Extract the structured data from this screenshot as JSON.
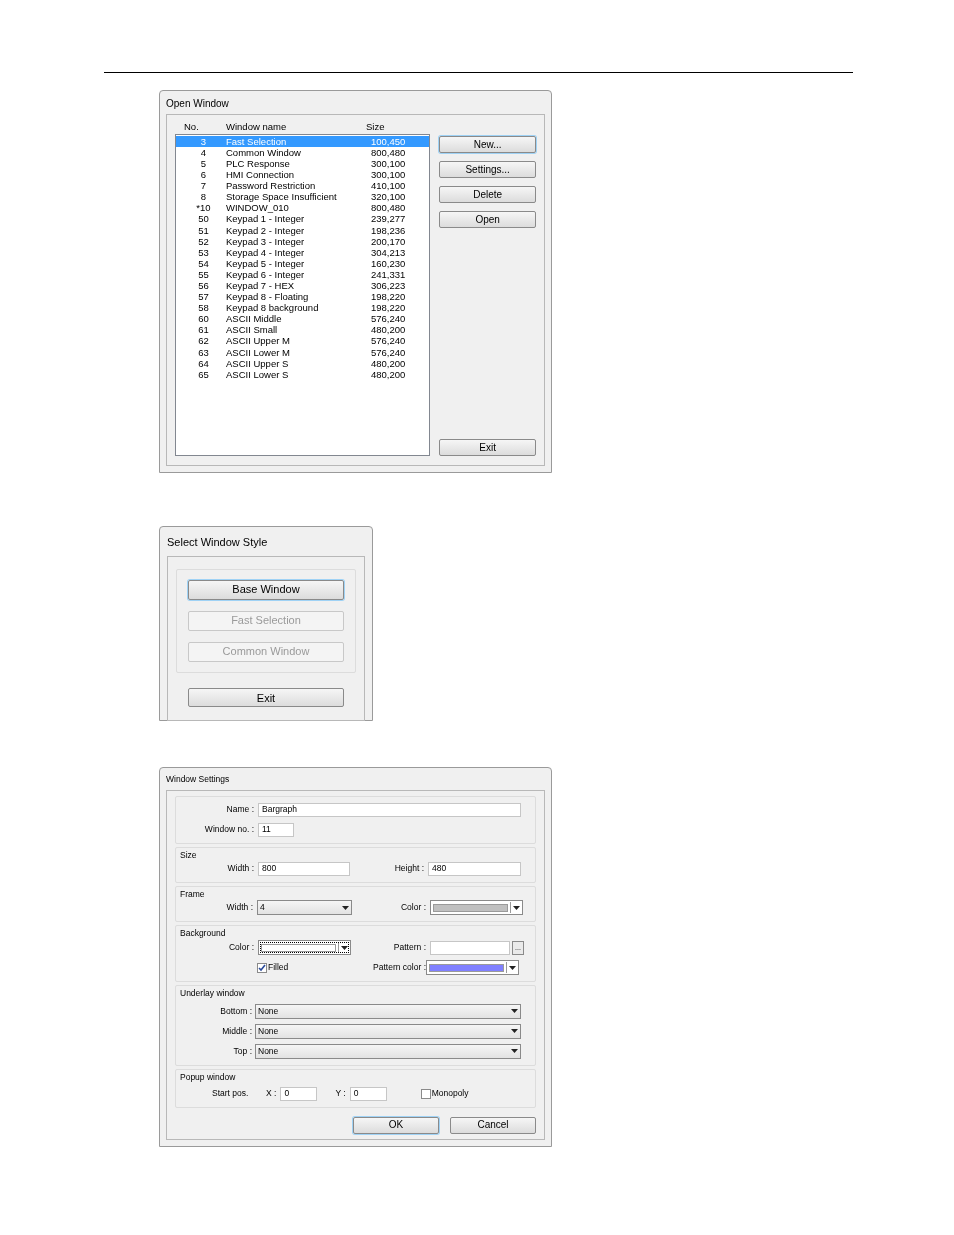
{
  "open_window": {
    "title": "Open Window",
    "columns": [
      "No.",
      "Window name",
      "Size"
    ],
    "rows": [
      {
        "no": "3",
        "name": "Fast Selection",
        "size": "100,450",
        "selected": true
      },
      {
        "no": "4",
        "name": "Common Window",
        "size": "800,480",
        "selected": false
      },
      {
        "no": "5",
        "name": "PLC Response",
        "size": "300,100",
        "selected": false
      },
      {
        "no": "6",
        "name": "HMI Connection",
        "size": "300,100",
        "selected": false
      },
      {
        "no": "7",
        "name": "Password Restriction",
        "size": "410,100",
        "selected": false
      },
      {
        "no": "8",
        "name": "Storage Space Insufficient",
        "size": "320,100",
        "selected": false
      },
      {
        "no": "*10",
        "name": "WINDOW_010",
        "size": "800,480",
        "selected": false
      },
      {
        "no": "50",
        "name": "Keypad 1 - Integer",
        "size": "239,277",
        "selected": false
      },
      {
        "no": "51",
        "name": "Keypad 2 - Integer",
        "size": "198,236",
        "selected": false
      },
      {
        "no": "52",
        "name": "Keypad 3 - Integer",
        "size": "200,170",
        "selected": false
      },
      {
        "no": "53",
        "name": "Keypad 4 - Integer",
        "size": "304,213",
        "selected": false
      },
      {
        "no": "54",
        "name": "Keypad 5 - Integer",
        "size": "160,230",
        "selected": false
      },
      {
        "no": "55",
        "name": "Keypad 6 - Integer",
        "size": "241,331",
        "selected": false
      },
      {
        "no": "56",
        "name": "Keypad 7 - HEX",
        "size": "306,223",
        "selected": false
      },
      {
        "no": "57",
        "name": "Keypad 8 - Floating",
        "size": "198,220",
        "selected": false
      },
      {
        "no": "58",
        "name": "Keypad 8 background",
        "size": "198,220",
        "selected": false
      },
      {
        "no": "60",
        "name": "ASCII Middle",
        "size": "576,240",
        "selected": false
      },
      {
        "no": "61",
        "name": "ASCII Small",
        "size": "480,200",
        "selected": false
      },
      {
        "no": "62",
        "name": "ASCII Upper M",
        "size": "576,240",
        "selected": false
      },
      {
        "no": "63",
        "name": "ASCII Lower M",
        "size": "576,240",
        "selected": false
      },
      {
        "no": "64",
        "name": "ASCII Upper S",
        "size": "480,200",
        "selected": false
      },
      {
        "no": "65",
        "name": "ASCII Lower S",
        "size": "480,200",
        "selected": false
      }
    ],
    "buttons": [
      {
        "label": "New...",
        "focused": true
      },
      {
        "label": "Settings...",
        "focused": false
      },
      {
        "label": "Delete",
        "focused": false
      },
      {
        "label": "Open",
        "focused": false
      }
    ],
    "exit": "Exit"
  },
  "select_style": {
    "title": "Select Window Style",
    "options": [
      {
        "label": "Base Window",
        "disabled": false,
        "focused": true
      },
      {
        "label": "Fast Selection",
        "disabled": true,
        "focused": false
      },
      {
        "label": "Common Window",
        "disabled": true,
        "focused": false
      }
    ],
    "exit": "Exit"
  },
  "window_settings": {
    "title": "Window Settings",
    "general": [
      {
        "label": "Name :",
        "value": "Bargraph"
      },
      {
        "label": "Window no. :",
        "value": "11"
      }
    ],
    "size": {
      "title": "Size",
      "width": {
        "label": "Width :",
        "value": "800"
      },
      "height": {
        "label": "Height :",
        "value": "480"
      }
    },
    "frame": {
      "title": "Frame",
      "width": {
        "label": "Width :",
        "value": "4"
      },
      "color": {
        "label": "Color :",
        "color": "#c0c0c0"
      }
    },
    "background": {
      "title": "Background",
      "color": {
        "label": "Color :",
        "color": "#ffffff"
      },
      "pattern": {
        "label": "Pattern :",
        "button": "..."
      },
      "filled": {
        "label": "Filled",
        "checked": true
      },
      "pattern_color": {
        "label": "Pattern color :",
        "color": "#8080ff"
      }
    },
    "underlay": {
      "title": "Underlay window",
      "selects": [
        {
          "label": "Bottom :",
          "value": "None"
        },
        {
          "label": "Middle :",
          "value": "None"
        },
        {
          "label": "Top :",
          "value": "None"
        }
      ]
    },
    "popup": {
      "title": "Popup window",
      "start_label": "Start pos.",
      "x": {
        "label": "X :",
        "value": "0"
      },
      "y": {
        "label": "Y :",
        "value": "0"
      },
      "monopoly": {
        "label": "Monopoly",
        "checked": false
      }
    },
    "buttons": [
      {
        "label": "OK",
        "focused": true
      },
      {
        "label": "Cancel",
        "focused": false
      }
    ]
  }
}
